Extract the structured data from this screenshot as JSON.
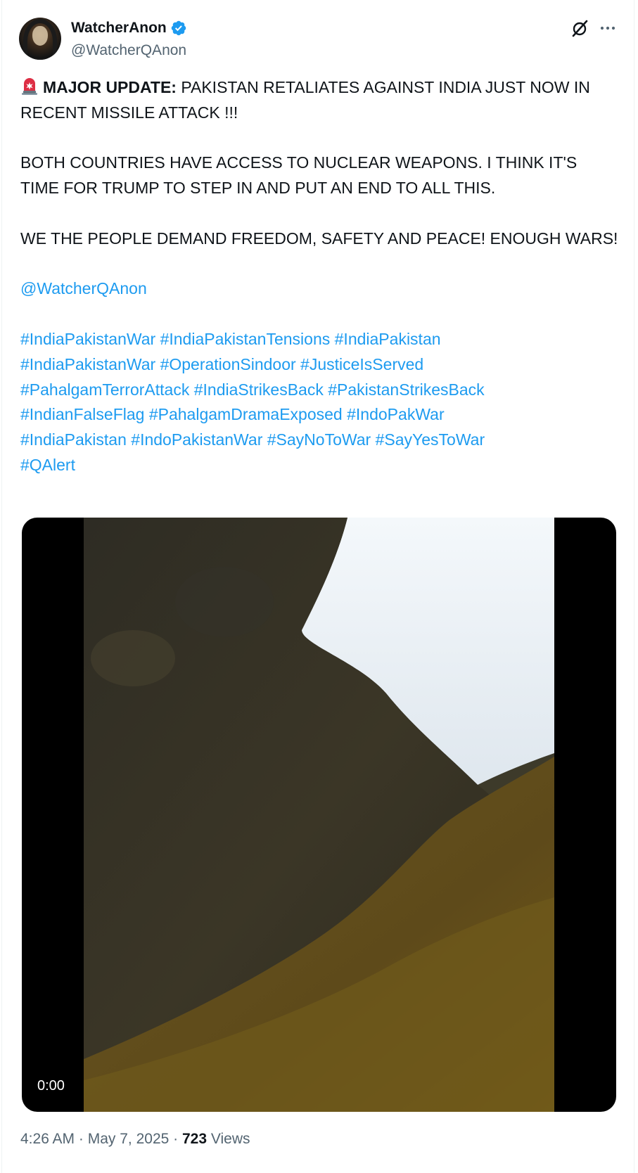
{
  "author": {
    "display_name": "WatcherAnon",
    "handle": "@WatcherQAnon",
    "verified": true,
    "avatar_icon": "anonymous-mask-avatar"
  },
  "header_actions": {
    "grok_icon": "grok-slash-icon",
    "more_icon": "more-horizontal-icon"
  },
  "tweet": {
    "emoji": "rotating-light-emoji",
    "headline_label": "MAJOR UPDATE:",
    "headline_text": " PAKISTAN RETALIATES AGAINST INDIA JUST NOW IN RECENT MISSILE ATTACK !!!",
    "paragraph2": "BOTH COUNTRIES HAVE ACCESS TO NUCLEAR WEAPONS. I THINK IT'S TIME FOR TRUMP TO STEP IN AND PUT AN END TO ALL THIS.",
    "paragraph3": "WE THE PEOPLE DEMAND FREEDOM, SAFETY AND PEACE! ENOUGH WARS!",
    "mention": "@WatcherQAnon",
    "hashtags": [
      "#IndiaPakistanWar",
      "#IndiaPakistanTensions",
      "#IndiaPakistan",
      "#IndiaPakistanWar",
      "#OperationSindoor",
      "#JusticeIsServed",
      "#PahalgamTerrorAttack",
      "#IndiaStrikesBack",
      "#PakistanStrikesBack",
      "#IndianFalseFlag",
      "#PahalgamDramaExposed",
      "#IndoPakWar",
      "#IndiaPakistan",
      "#IndoPakistanWar",
      "#SayNoToWar",
      "#SayYesToWar",
      "#QAlert"
    ]
  },
  "video": {
    "duration": "0:00"
  },
  "meta": {
    "time": "4:26 AM",
    "separator": " · ",
    "date": "May 7, 2025",
    "views_count": "723",
    "views_label": " Views"
  },
  "colors": {
    "link": "#1d9bf0",
    "text": "#0f1419",
    "secondary": "#536471",
    "verified": "#1d9bf0"
  }
}
